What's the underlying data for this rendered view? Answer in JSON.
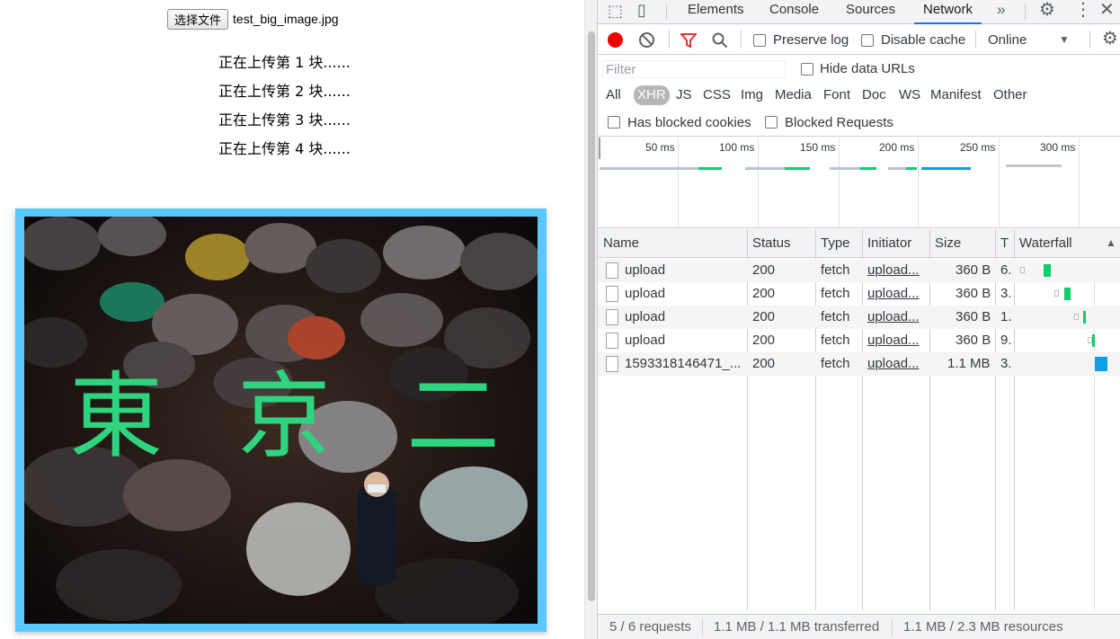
{
  "page": {
    "file_button": "选择文件",
    "file_name": "test_big_image.jpg",
    "log_lines": [
      "正在上传第 1 块......",
      "正在上传第 2 块......",
      "正在上传第 3 块......",
      "正在上传第 4 块......"
    ],
    "overlay_chars": [
      "東",
      "京",
      "二"
    ]
  },
  "devtools": {
    "tabs": [
      "Elements",
      "Console",
      "Sources",
      "Network"
    ],
    "active_tab": "Network",
    "more_tabs_icon": "chevron-double-right-icon",
    "toolbar": {
      "preserve_log": "Preserve log",
      "disable_cache": "Disable cache",
      "throttle": "Online"
    },
    "filter": {
      "placeholder": "Filter",
      "hide_data_urls": "Hide data URLs",
      "types": [
        "All",
        "XHR",
        "JS",
        "CSS",
        "Img",
        "Media",
        "Font",
        "Doc",
        "WS",
        "Manifest",
        "Other"
      ],
      "selected_type": "XHR",
      "has_blocked_cookies": "Has blocked cookies",
      "blocked_requests": "Blocked Requests"
    },
    "overview": {
      "ticks": [
        "50 ms",
        "100 ms",
        "150 ms",
        "200 ms",
        "250 ms",
        "300 ms"
      ]
    },
    "table": {
      "headers": [
        "Name",
        "Status",
        "Type",
        "Initiator",
        "Size",
        "T",
        "Waterfall"
      ],
      "rows": [
        {
          "name": "upload",
          "status": "200",
          "type": "fetch",
          "initiator": "upload...",
          "size": "360 B",
          "time": "6."
        },
        {
          "name": "upload",
          "status": "200",
          "type": "fetch",
          "initiator": "upload...",
          "size": "360 B",
          "time": "3."
        },
        {
          "name": "upload",
          "status": "200",
          "type": "fetch",
          "initiator": "upload...",
          "size": "360 B",
          "time": "1."
        },
        {
          "name": "upload",
          "status": "200",
          "type": "fetch",
          "initiator": "upload...",
          "size": "360 B",
          "time": "9."
        },
        {
          "name": "1593318146471_...",
          "status": "200",
          "type": "fetch",
          "initiator": "upload...",
          "size": "1.1 MB",
          "time": "3."
        }
      ]
    },
    "status_bar": {
      "requests": "5 / 6 requests",
      "transferred": "1.1 MB / 1.1 MB transferred",
      "resources": "1.1 MB / 2.3 MB resources"
    },
    "colors": {
      "accent": "#1a73e8",
      "record": "#ee0000",
      "waterfall_green": "#0cce6b",
      "waterfall_blue": "#0e9de7",
      "preview_border": "#5ac8fa",
      "overlay_text": "#2fd47e"
    }
  }
}
